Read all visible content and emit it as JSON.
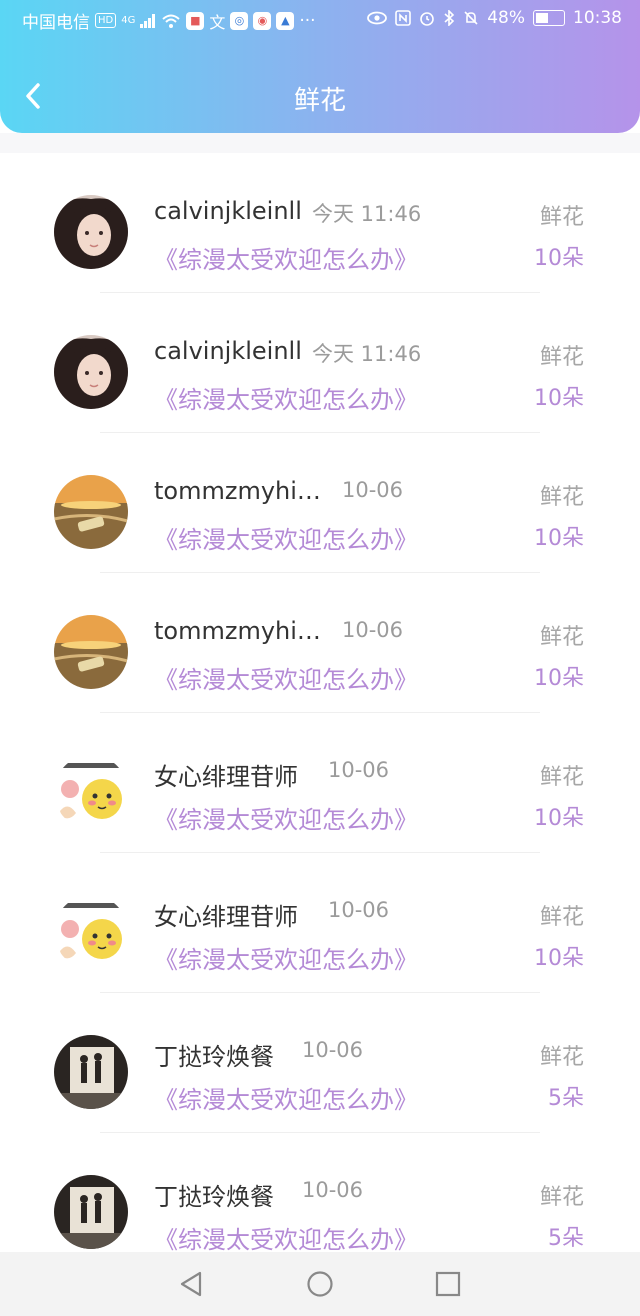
{
  "status_bar": {
    "carrier": "中国电信",
    "hd": "HD",
    "network": "4G",
    "app_icons": [
      "app-icon-1",
      "app-icon-2",
      "app-icon-3",
      "app-icon-4",
      "app-icon-5"
    ],
    "more": "···",
    "battery": "48%",
    "time": "10:38"
  },
  "header": {
    "title": "鲜花",
    "back_icon": "chevron-left-icon",
    "gradient": [
      "#5ad6f4",
      "#b593ea"
    ]
  },
  "colors": {
    "accent": "#b48ad6",
    "muted": "#9b9b9b",
    "name": "#333333"
  },
  "rows": [
    {
      "avatar": "avatar-girl",
      "name": "calvinjkleinll",
      "time": "今天 11:46",
      "book": "《综漫太受欢迎怎么办》",
      "kind": "鲜花",
      "amount": "10朵"
    },
    {
      "avatar": "avatar-girl",
      "name": "calvinjkleinll",
      "time": "今天 11:46",
      "book": "《综漫太受欢迎怎么办》",
      "kind": "鲜花",
      "amount": "10朵"
    },
    {
      "avatar": "avatar-beach",
      "name": "tommzmyhil...",
      "time": "10-06",
      "book": "《综漫太受欢迎怎么办》",
      "kind": "鲜花",
      "amount": "10朵"
    },
    {
      "avatar": "avatar-beach",
      "name": "tommzmyhil...",
      "time": "10-06",
      "book": "《综漫太受欢迎怎么办》",
      "kind": "鲜花",
      "amount": "10朵"
    },
    {
      "avatar": "avatar-emoji",
      "name": "女心绯理苷师",
      "time": "10-06",
      "book": "《综漫太受欢迎怎么办》",
      "kind": "鲜花",
      "amount": "10朵"
    },
    {
      "avatar": "avatar-emoji",
      "name": "女心绯理苷师",
      "time": "10-06",
      "book": "《综漫太受欢迎怎么办》",
      "kind": "鲜花",
      "amount": "10朵"
    },
    {
      "avatar": "avatar-couple",
      "name": "丁挞玲焕餐",
      "time": "10-06",
      "book": "《综漫太受欢迎怎么办》",
      "kind": "鲜花",
      "amount": "5朵"
    },
    {
      "avatar": "avatar-couple",
      "name": "丁挞玲焕餐",
      "time": "10-06",
      "book": "《综漫太受欢迎怎么办》",
      "kind": "鲜花",
      "amount": "5朵"
    }
  ],
  "nav_bar": {
    "back": "triangle-back-icon",
    "home": "circle-home-icon",
    "recents": "square-recents-icon"
  }
}
